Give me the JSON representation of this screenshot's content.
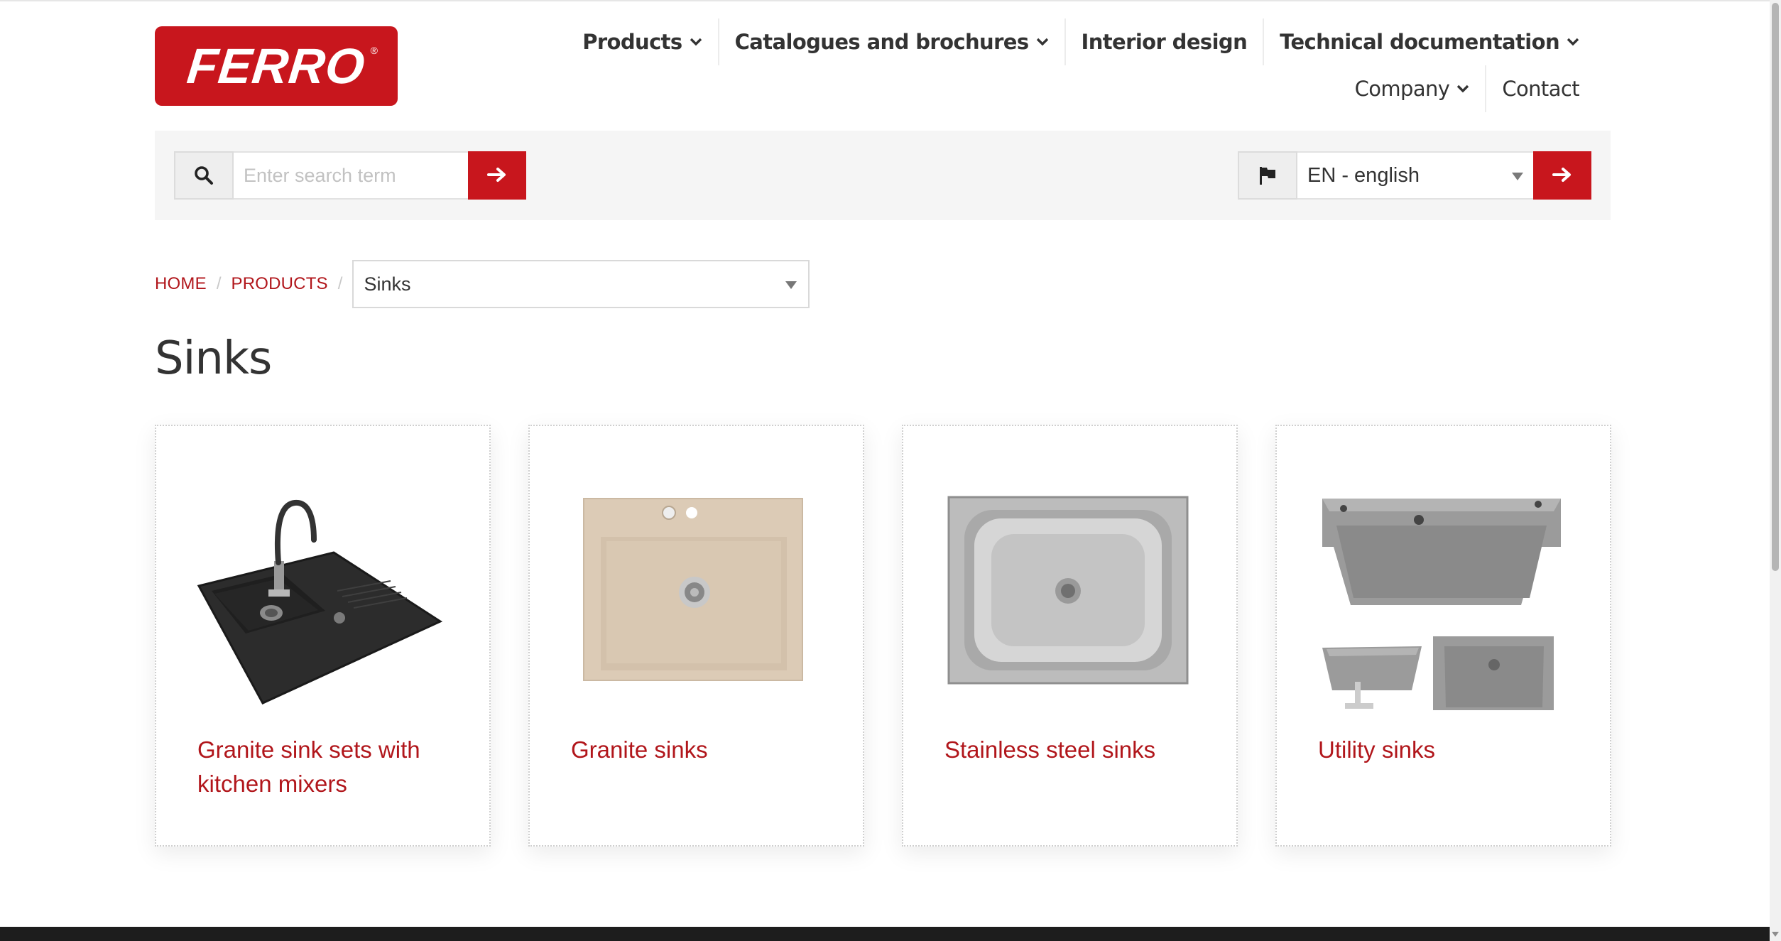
{
  "brand": {
    "logo_text": "FERRO",
    "logo_mark": "®",
    "primary_color": "#c8161d"
  },
  "nav": {
    "row1": [
      {
        "label": "Products",
        "dropdown": true
      },
      {
        "label": "Catalogues and brochures",
        "dropdown": true
      },
      {
        "label": "Interior design",
        "dropdown": false
      },
      {
        "label": "Technical documentation",
        "dropdown": true
      }
    ],
    "row2": [
      {
        "label": "Company",
        "dropdown": true
      },
      {
        "label": "Contact",
        "dropdown": false
      }
    ]
  },
  "search": {
    "placeholder": "Enter search term",
    "value": "",
    "icon": "search-icon",
    "submit_icon": "arrow-right-icon"
  },
  "language": {
    "icon": "flag-icon",
    "selected": "EN - english",
    "submit_icon": "arrow-right-icon"
  },
  "breadcrumb": {
    "items": [
      "HOME",
      "PRODUCTS"
    ],
    "separator": "/",
    "current_select": "Sinks"
  },
  "page": {
    "title": "Sinks"
  },
  "categories": [
    {
      "label": "Granite sink sets with kitchen mixers",
      "image": "granite-sink-set-with-mixer"
    },
    {
      "label": "Granite sinks",
      "image": "granite-sink"
    },
    {
      "label": "Stainless steel sinks",
      "image": "stainless-steel-sink"
    },
    {
      "label": "Utility sinks",
      "image": "utility-sinks"
    }
  ]
}
